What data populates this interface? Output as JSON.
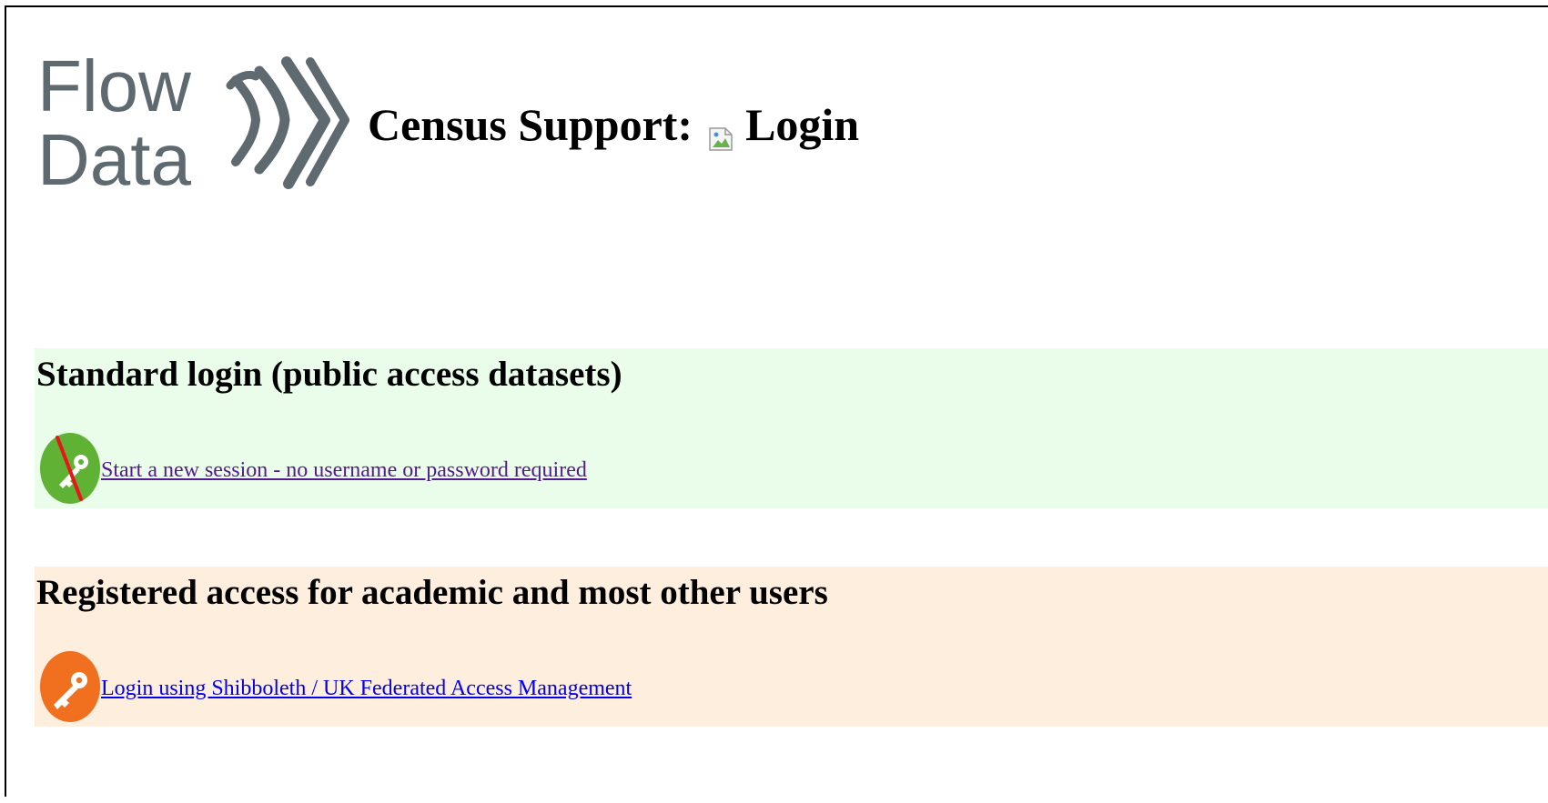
{
  "header": {
    "logo_line1": "Flow",
    "logo_line2": "Data",
    "title_prefix": "Census Support:",
    "title_suffix": "Login"
  },
  "sections": {
    "standard": {
      "heading": "Standard login (public access datasets)",
      "link_label": "Start a new session - no username or password required",
      "icon": "key-crossed-icon",
      "background": "#eafdea",
      "icon_color": "#5fb233"
    },
    "registered": {
      "heading": "Registered access for academic and most other users",
      "link_label": "Login using Shibboleth / UK Federated Access Management",
      "icon": "key-icon",
      "background": "#fdeede",
      "icon_color": "#f07020"
    }
  },
  "colors": {
    "logo": "#5f6a70",
    "link_visited": "#551a8b",
    "link_unvisited": "#0000ee"
  }
}
